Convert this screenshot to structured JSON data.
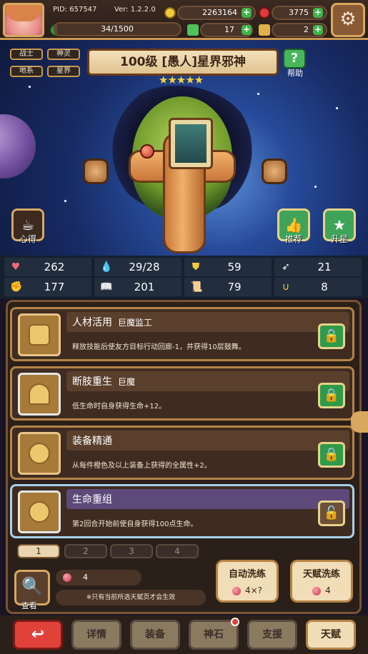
{
  "header": {
    "pid": "PID: 657547",
    "version": "Ver: 1.2.2.0",
    "gold": "2263164",
    "ruby": "3775",
    "exp": "34/1500",
    "exp_fraction": 0.0227,
    "clover": "17",
    "key": "2"
  },
  "hero": {
    "tags": [
      "战士",
      "神灵",
      "地系",
      "星界"
    ],
    "title": "100级  [愚人]星界邪神",
    "stars": "★★★★★",
    "help_label": "帮助",
    "left_btn_label": "心得",
    "recommend_label": "推荐",
    "upgrade_label": "升星"
  },
  "stats": [
    {
      "icon": "heart-icon",
      "value": "262"
    },
    {
      "icon": "drop-icon",
      "value": "29/28"
    },
    {
      "icon": "shield-icon",
      "value": "59"
    },
    {
      "icon": "wing-icon",
      "value": "21"
    },
    {
      "icon": "fist-icon",
      "value": "177"
    },
    {
      "icon": "book-icon",
      "value": "201"
    },
    {
      "icon": "scroll-icon",
      "value": "79"
    },
    {
      "icon": "horseshoe-icon",
      "value": "8"
    }
  ],
  "talents": [
    {
      "name": "人材活用",
      "sub": "巨魔监工",
      "desc": "释放技能后使友方目标行动回廊-1，并获得10层鼓舞。",
      "locked": true
    },
    {
      "name": "断肢重生",
      "sub": "巨魔",
      "desc": "低生命时自身获得生命+12。",
      "locked": true
    },
    {
      "name": "装备精通",
      "sub": "",
      "desc": "从每件橙色及以上装备上获得的全属性+2。",
      "locked": true
    },
    {
      "name": "生命重组",
      "sub": "",
      "desc": "第2回合开始前使自身获得100点生命。",
      "locked": false
    }
  ],
  "pages": [
    "1",
    "2",
    "3",
    "4"
  ],
  "bottom": {
    "search_label": "查看",
    "gem_count": "4",
    "note": "※只有当前所选天赋页才会生效",
    "auto_wash_title": "自动洗练",
    "auto_wash_cost": "4×?",
    "talent_wash_title": "天赋洗练",
    "talent_wash_cost": "4"
  },
  "nav": {
    "back": "↩",
    "details": "详情",
    "equip": "装备",
    "stone": "神石",
    "support": "支援",
    "talent": "天赋"
  }
}
